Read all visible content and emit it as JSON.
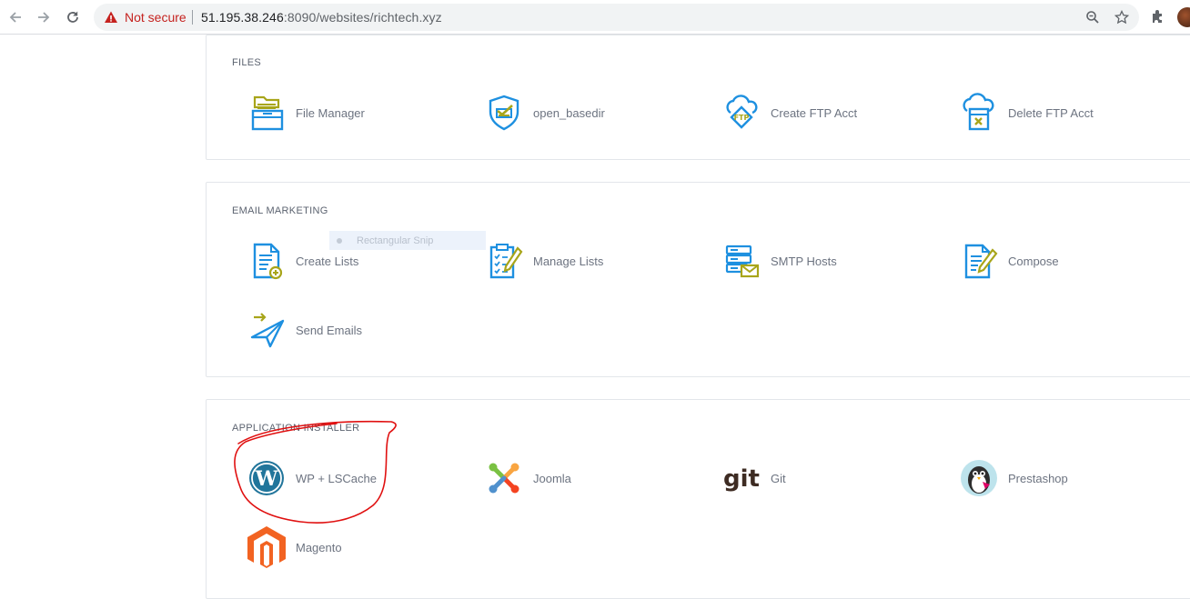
{
  "browser": {
    "security_label": "Not secure",
    "url_host": "51.195.38.246",
    "url_rest": ":8090/websites/richtech.xyz"
  },
  "sections": {
    "files": {
      "title": "FILES",
      "items": [
        {
          "label": "File Manager",
          "icon": "file-manager-icon"
        },
        {
          "label": "open_basedir",
          "icon": "shield-check-icon"
        },
        {
          "label": "Create FTP Acct",
          "icon": "ftp-cloud-icon"
        },
        {
          "label": "Delete FTP Acct",
          "icon": "ftp-delete-icon"
        }
      ]
    },
    "email_marketing": {
      "title": "EMAIL MARKETING",
      "items": [
        {
          "label": "Create Lists",
          "icon": "create-list-icon"
        },
        {
          "label": "Manage Lists",
          "icon": "manage-list-icon"
        },
        {
          "label": "SMTP Hosts",
          "icon": "smtp-server-icon"
        },
        {
          "label": "Compose",
          "icon": "compose-icon"
        },
        {
          "label": "Send Emails",
          "icon": "paper-plane-icon"
        }
      ]
    },
    "app_installer": {
      "title": "APPLICATION INSTALLER",
      "items": [
        {
          "label": "WP + LSCache",
          "icon": "wordpress-icon"
        },
        {
          "label": "Joomla",
          "icon": "joomla-icon"
        },
        {
          "label": "Git",
          "icon": "git-icon"
        },
        {
          "label": "Prestashop",
          "icon": "prestashop-icon"
        },
        {
          "label": "Magento",
          "icon": "magento-icon"
        }
      ]
    }
  },
  "overlay": {
    "snip_label": "Rectangular Snip"
  },
  "icons": {
    "git_text": "git"
  },
  "colors": {
    "accent_blue": "#1e90e0",
    "accent_olive": "#a8a51a",
    "annotation_red": "#e01010"
  }
}
